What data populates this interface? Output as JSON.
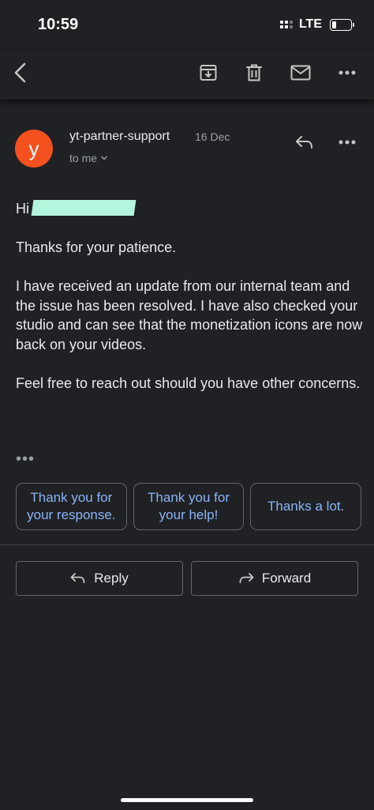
{
  "status_bar": {
    "time": "10:59",
    "network": "LTE"
  },
  "ghost_subject": "",
  "email": {
    "sender_initial": "y",
    "sender_name": "yt-partner-support",
    "date": "16 Dec",
    "recipient": "to me",
    "greeting": "Hi",
    "paragraphs": [
      "Thanks for your patience.",
      "I have received an update from our internal team and the issue has been resolved. I have also checked your studio and can see that the monetization icons are now back on your videos.",
      "Feel free to reach out should you have other concerns."
    ],
    "more": "•••"
  },
  "smart_replies": [
    "Thank you for your response.",
    "Thank you for your help!",
    "Thanks a lot."
  ],
  "actions": {
    "reply_label": "Reply",
    "forward_label": "Forward"
  },
  "colors": {
    "background": "#202124",
    "avatar": "#f4511e",
    "link": "#8ab4f8",
    "redaction": "#b3f5dd"
  }
}
